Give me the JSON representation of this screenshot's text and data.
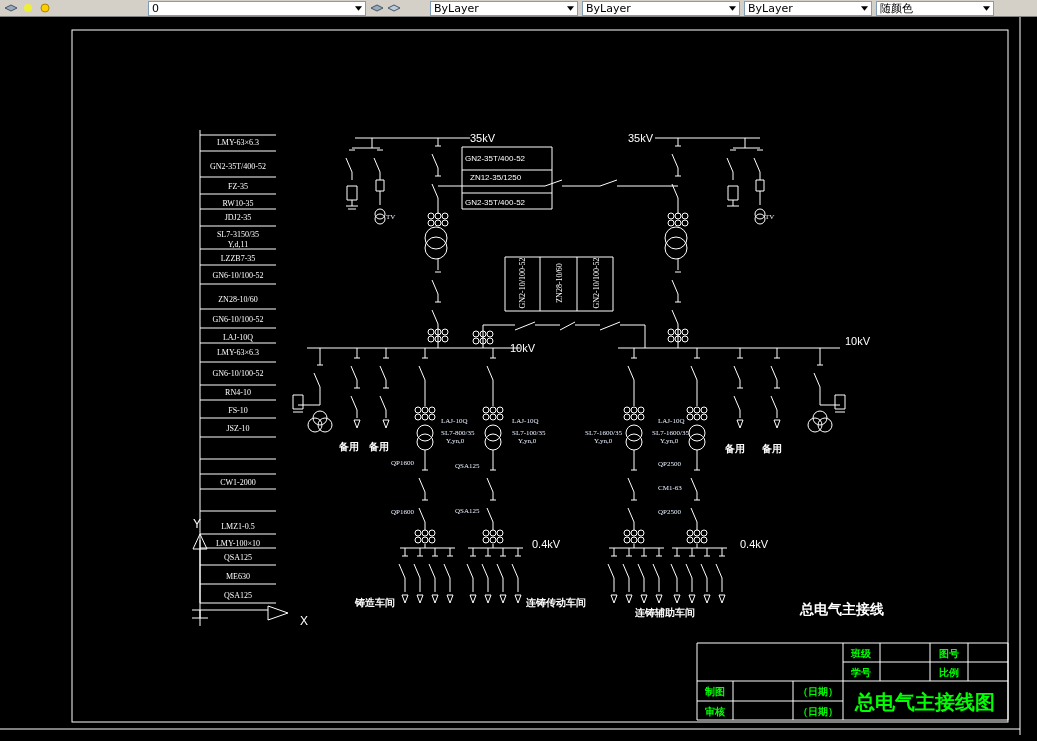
{
  "toolbar": {
    "layer": "0",
    "color_setting": "ByLayer",
    "linetype": "ByLayer",
    "lineweight": "ByLayer",
    "plot_style": "随颜色"
  },
  "legend": [
    "LMY-63×6.3",
    "GN2-35T/400-52",
    "FZ-35",
    "RW10-35",
    "JDJ2-35",
    "SL7-3150/35",
    "Y,d,11",
    "LZZB7-35",
    "GN6-10/100-52",
    "ZN28-10/60",
    "GN6-10/100-52",
    "LAJ-10Q",
    "LMY-63×6.3",
    "GN6-10/100-52",
    "RN4-10",
    "FS-10",
    "JSZ-10",
    "CW1-2000",
    "LMZ1-0.5",
    "LMY-100×10",
    "QSA125",
    "ME630",
    "QSA125"
  ],
  "labels": [
    {
      "kind": "voltage",
      "text": "35kV"
    },
    {
      "kind": "voltage",
      "text": "35kV"
    },
    {
      "kind": "spec",
      "text": "GN2-35T/400-52"
    },
    {
      "kind": "spec",
      "text": "ZN12-35/1250"
    },
    {
      "kind": "spec",
      "text": "GN2-35T/400-52"
    },
    {
      "kind": "tag",
      "text": "TV"
    },
    {
      "kind": "tag",
      "text": "TV"
    },
    {
      "kind": "panel",
      "text": "GN2-10/100-52"
    },
    {
      "kind": "panel",
      "text": "ZN28-10/60"
    },
    {
      "kind": "panel",
      "text": "GN2-10/100-52"
    },
    {
      "kind": "voltage",
      "text": "10kV"
    },
    {
      "kind": "voltage",
      "text": "10kV"
    },
    {
      "kind": "tag",
      "text": "LAJ-10Q"
    },
    {
      "kind": "tag",
      "text": "SL7-800/35"
    },
    {
      "kind": "tag",
      "text": "Y,yn,0"
    },
    {
      "kind": "tag",
      "text": "LAJ-10Q"
    },
    {
      "kind": "tag",
      "text": "SL7-100/35"
    },
    {
      "kind": "tag",
      "text": "Y,yn,0"
    },
    {
      "kind": "tag",
      "text": "SL7-1600/35"
    },
    {
      "kind": "tag",
      "text": "Y,yn,0"
    },
    {
      "kind": "tag",
      "text": "LAJ-10Q"
    },
    {
      "kind": "tag",
      "text": "SL7-1600/35"
    },
    {
      "kind": "tag",
      "text": "Y,yn,0"
    },
    {
      "kind": "cjk",
      "text": "备用"
    },
    {
      "kind": "cjk",
      "text": "备用"
    },
    {
      "kind": "cjk",
      "text": "备用"
    },
    {
      "kind": "cjk",
      "text": "备用"
    },
    {
      "kind": "tag",
      "text": "QP1600"
    },
    {
      "kind": "tag",
      "text": "QSA125"
    },
    {
      "kind": "tag",
      "text": "QP2500"
    },
    {
      "kind": "tag",
      "text": "CM1-63"
    },
    {
      "kind": "tag",
      "text": "QP1600"
    },
    {
      "kind": "tag",
      "text": "QSA125"
    },
    {
      "kind": "tag",
      "text": "QP2500"
    },
    {
      "kind": "voltage",
      "text": "0.4kV"
    },
    {
      "kind": "voltage",
      "text": "0.4kV"
    },
    {
      "kind": "cjk",
      "text": "铸造车间"
    },
    {
      "kind": "cjk",
      "text": "连铸传动车间"
    },
    {
      "kind": "cjk",
      "text": "连铸辅助车间"
    },
    {
      "kind": "title",
      "text": "总电气主接线"
    }
  ],
  "ucs_labels": [
    "X",
    "Y"
  ],
  "title_block": {
    "class_label": "班级",
    "drawing_no_label": "图号",
    "student_no_label": "学号",
    "scale_label": "比例",
    "drawn_by_label": "制图",
    "drawn_date": "（日期）",
    "checked_by_label": "审核",
    "checked_date": "（日期）",
    "title": "总电气主接线图"
  }
}
